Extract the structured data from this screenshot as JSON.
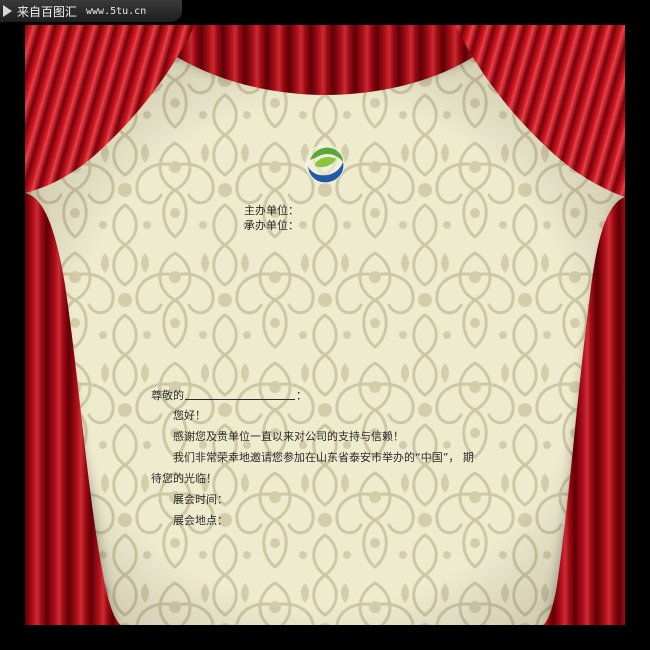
{
  "watermark": {
    "site_name": "来自百图汇",
    "url": "www.5tu.cn",
    "icon": "play-arrow-icon"
  },
  "invitation": {
    "logo_icon": "blue-green-swirl-logo",
    "organizer_label": "主办单位：",
    "co_organizer_label": "承办单位：",
    "salutation_prefix": "尊敬的",
    "salutation_suffix": "：",
    "greeting": "您好！",
    "thanks_line": "感谢您及贵单位一直以来对公司的支持与信赖！",
    "invite_line_1": "我们非常荣幸地邀请您参加在山东省泰安市举办的“中国”，  期",
    "invite_line_2": "待您的光临！",
    "time_label": "展会时间：",
    "venue_label": "展会地点："
  },
  "colors": {
    "background_frame": "#000000",
    "paper": "#efebcf",
    "damask_pattern": "#cdc7a4",
    "curtain_red": "#c3101b",
    "curtain_dark": "#6a0008",
    "text": "#2a2a2a",
    "logo_blue": "#1f5aa6",
    "logo_green": "#5aa83a"
  }
}
